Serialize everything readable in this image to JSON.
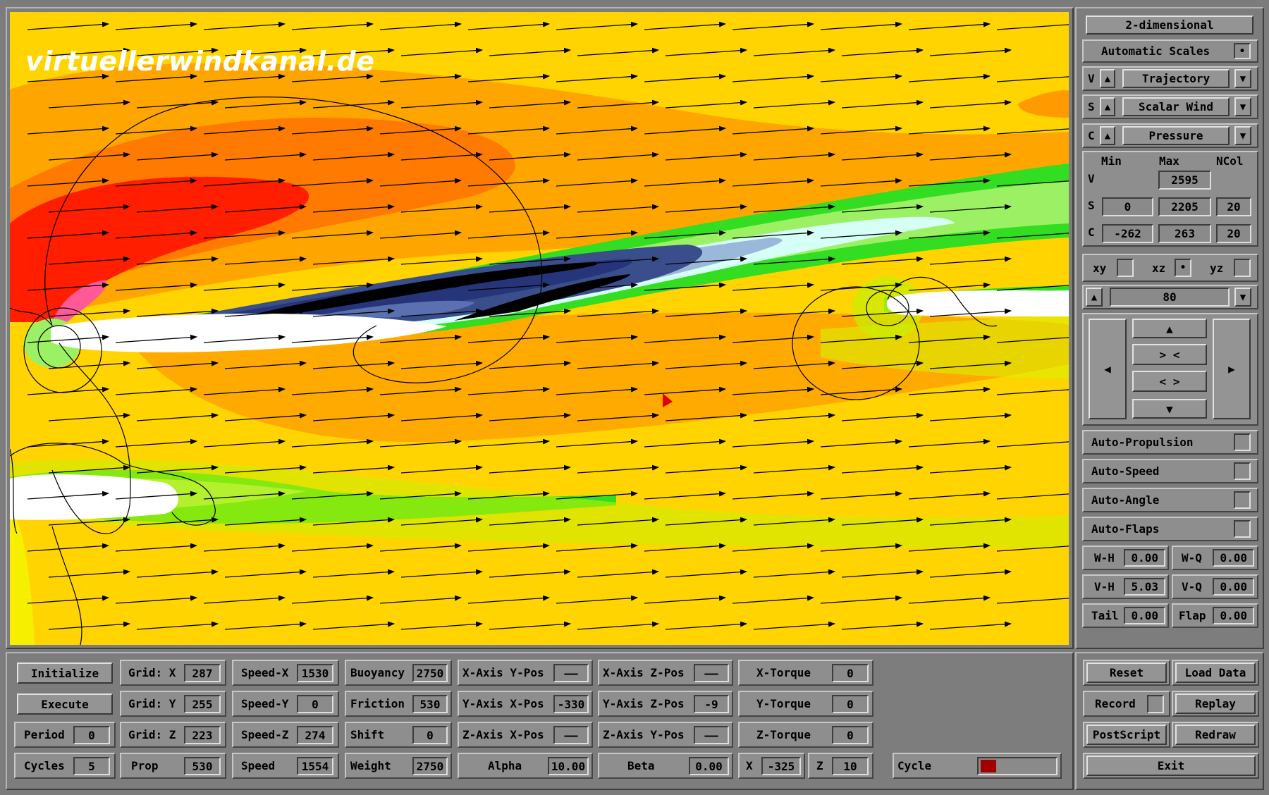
{
  "watermark": "virtuellerwindkanal.de",
  "colors": {
    "window_bg": "#7c7c7c",
    "field_yellow": "#ffd200",
    "accent_red": "#a00000"
  },
  "side": {
    "mode_button": "2-dimensional",
    "auto_scales": {
      "label": "Automatic Scales",
      "checked": true
    },
    "v_select": {
      "key": "V",
      "value": "Trajectory"
    },
    "s_select": {
      "key": "S",
      "value": "Scalar Wind"
    },
    "c_select": {
      "key": "C",
      "value": "Pressure"
    },
    "scale_headers": {
      "min": "Min",
      "max": "Max",
      "ncol": "NCol"
    },
    "scale_rows": {
      "v": {
        "key": "V",
        "max": "2595"
      },
      "s": {
        "key": "S",
        "min": "0",
        "max": "2205",
        "ncol": "20"
      },
      "c": {
        "key": "C",
        "min": "-262",
        "max": "263",
        "ncol": "20"
      }
    },
    "planes": {
      "xy": "xy",
      "xz": "xz",
      "yz": "yz",
      "selected": "xz"
    },
    "slice_value": "80",
    "nav": {
      "up": "▲",
      "down": "▼",
      "left": "◀",
      "right": "▶",
      "zoom_in": "> <",
      "zoom_out": "< >"
    },
    "autos": [
      "Auto-Propulsion",
      "Auto-Speed",
      "Auto-Angle",
      "Auto-Flaps"
    ],
    "params": {
      "wh": {
        "label": "W-H",
        "value": "0.00"
      },
      "wq": {
        "label": "W-Q",
        "value": "0.00"
      },
      "vh": {
        "label": "V-H",
        "value": "5.03"
      },
      "vq": {
        "label": "V-Q",
        "value": "0.00"
      },
      "tail": {
        "label": "Tail",
        "value": "0.00"
      },
      "flap": {
        "label": "Flap",
        "value": "0.00"
      }
    }
  },
  "bottom": {
    "initialize": "Initialize",
    "execute": "Execute",
    "period": {
      "label": "Period",
      "value": "0"
    },
    "cycles": {
      "label": "Cycles",
      "value": "5"
    },
    "grid_x": {
      "label": "Grid: X",
      "value": "287"
    },
    "grid_y": {
      "label": "Grid: Y",
      "value": "255"
    },
    "grid_z": {
      "label": "Grid: Z",
      "value": "223"
    },
    "prop": {
      "label": "Prop",
      "value": "530"
    },
    "speed_x": {
      "label": "Speed-X",
      "value": "1530"
    },
    "speed_y": {
      "label": "Speed-Y",
      "value": "0"
    },
    "speed_z": {
      "label": "Speed-Z",
      "value": "274"
    },
    "speed": {
      "label": "Speed",
      "value": "1554"
    },
    "buoyancy": {
      "label": "Buoyancy",
      "value": "2750"
    },
    "friction": {
      "label": "Friction",
      "value": "530"
    },
    "shift": {
      "label": "Shift",
      "value": "0"
    },
    "weight": {
      "label": "Weight",
      "value": "2750"
    },
    "xaxis_ypos": {
      "label": "X-Axis Y-Pos",
      "value": "——"
    },
    "yaxis_xpos": {
      "label": "Y-Axis X-Pos",
      "value": "-330"
    },
    "zaxis_xpos": {
      "label": "Z-Axis X-Pos",
      "value": "——"
    },
    "xaxis_zpos": {
      "label": "X-Axis Z-Pos",
      "value": "——"
    },
    "yaxis_zpos": {
      "label": "Y-Axis Z-Pos",
      "value": "-9"
    },
    "zaxis_ypos": {
      "label": "Z-Axis Y-Pos",
      "value": "——"
    },
    "alpha": {
      "label": "Alpha",
      "value": "10.00"
    },
    "beta": {
      "label": "Beta",
      "value": "0.00"
    },
    "x_torque": {
      "label": "X-Torque",
      "value": "0"
    },
    "y_torque": {
      "label": "Y-Torque",
      "value": "0"
    },
    "z_torque": {
      "label": "Z-Torque",
      "value": "0"
    },
    "x": {
      "label": "X",
      "value": "-325"
    },
    "z": {
      "label": "Z",
      "value": "10"
    },
    "cycle": {
      "label": "Cycle",
      "progress": 0.12
    },
    "reset": "Reset",
    "load_data": "Load Data",
    "record": "Record",
    "replay": "Replay",
    "postscript": "PostScript",
    "redraw": "Redraw",
    "exit": "Exit"
  }
}
